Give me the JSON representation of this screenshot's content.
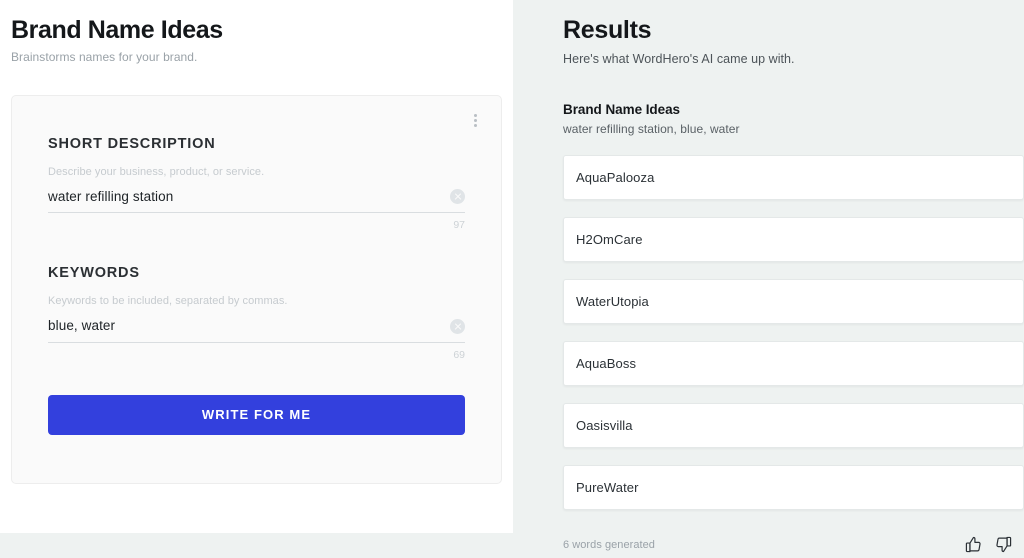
{
  "left": {
    "title": "Brand Name Ideas",
    "subtitle": "Brainstorms names for your brand.",
    "menu_icon": "kebab-vertical-icon",
    "fields": [
      {
        "label": "SHORT DESCRIPTION",
        "hint": "Describe your business, product, or service.",
        "value": "water refilling station",
        "placeholder": "Describe your business, product, or service.",
        "char_count": "97",
        "clear_icon": "clear-circle-icon"
      },
      {
        "label": "KEYWORDS",
        "hint": "Keywords to be included, separated by commas.",
        "value": "blue, water",
        "placeholder": "Keywords to be included, separated by commas.",
        "char_count": "69",
        "clear_icon": "clear-circle-icon"
      }
    ],
    "submit_label": "WRITE FOR ME",
    "submit_color": "#3340dd"
  },
  "right": {
    "title": "Results",
    "subtitle": "Here's what WordHero's AI came up with.",
    "group_title": "Brand Name Ideas",
    "group_subtitle": "water refilling station, blue, water",
    "results": [
      {
        "text": "AquaPalooza"
      },
      {
        "text": "H2OmCare"
      },
      {
        "text": "WaterUtopia"
      },
      {
        "text": "AquaBoss"
      },
      {
        "text": "Oasisvilla"
      },
      {
        "text": "PureWater"
      }
    ],
    "footer": {
      "words_generated": "6 words generated",
      "thumbs_up_icon": "thumbs-up-icon",
      "thumbs_down_icon": "thumbs-down-icon"
    }
  }
}
